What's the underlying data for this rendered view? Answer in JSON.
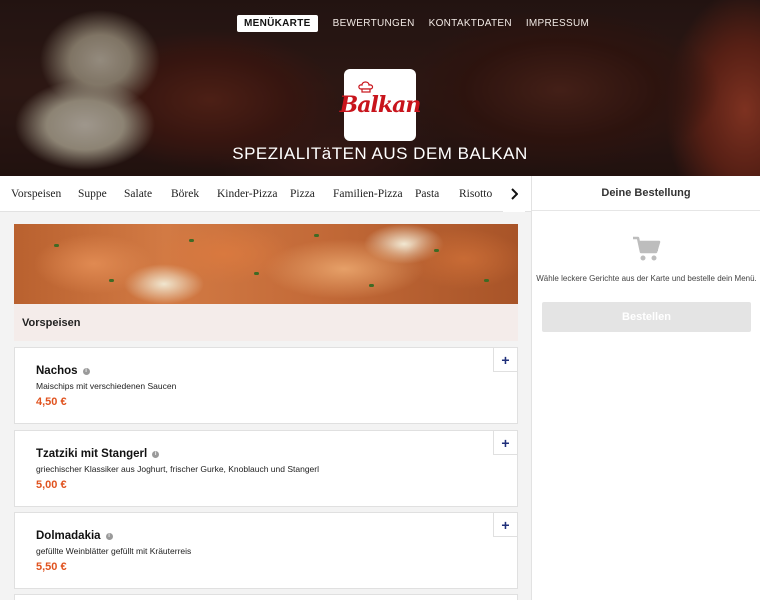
{
  "topnav": {
    "items": [
      {
        "label": "MENÜKARTE",
        "active": true
      },
      {
        "label": "BEWERTUNGEN",
        "active": false
      },
      {
        "label": "KONTAKTDATEN",
        "active": false
      },
      {
        "label": "IMPRESSUM",
        "active": false
      }
    ]
  },
  "hero": {
    "logo_text": "Balkan",
    "title": "SPEZIALITäTEN AUS DEM BALKAN"
  },
  "categories": {
    "items": [
      "Vorspeisen",
      "Suppe",
      "Salate",
      "Börek",
      "Kinder-Pizza",
      "Pizza",
      "Familien-Pizza",
      "Pasta",
      "Risotto"
    ],
    "next_icon": "chevron-right-icon"
  },
  "section": {
    "title": "Vorspeisen"
  },
  "menu_items": [
    {
      "name": "Nachos",
      "description": "Maischips mit verschiedenen Saucen",
      "price": "4,50 €",
      "add_label": "+"
    },
    {
      "name": "Tzatziki mit Stangerl",
      "description": "griechischer Klassiker aus Joghurt, frischer Gurke, Knoblauch und Stangerl",
      "price": "5,00 €",
      "add_label": "+"
    },
    {
      "name": "Dolmadakia",
      "description": "gefüllte Weinblätter gefüllt mit Kräuterreis",
      "price": "5,50 €",
      "add_label": "+"
    }
  ],
  "order": {
    "title": "Deine Bestellung",
    "hint": "Wähle leckere Gerichte aus der Karte und bestelle dein Menü.",
    "button_label": "Bestellen",
    "icon": "cart-icon"
  },
  "colors": {
    "price": "#e0531f",
    "add_button": "#1f2f7a",
    "section_head_bg": "#f4ecea",
    "order_button_bg": "#e4e4e4"
  }
}
